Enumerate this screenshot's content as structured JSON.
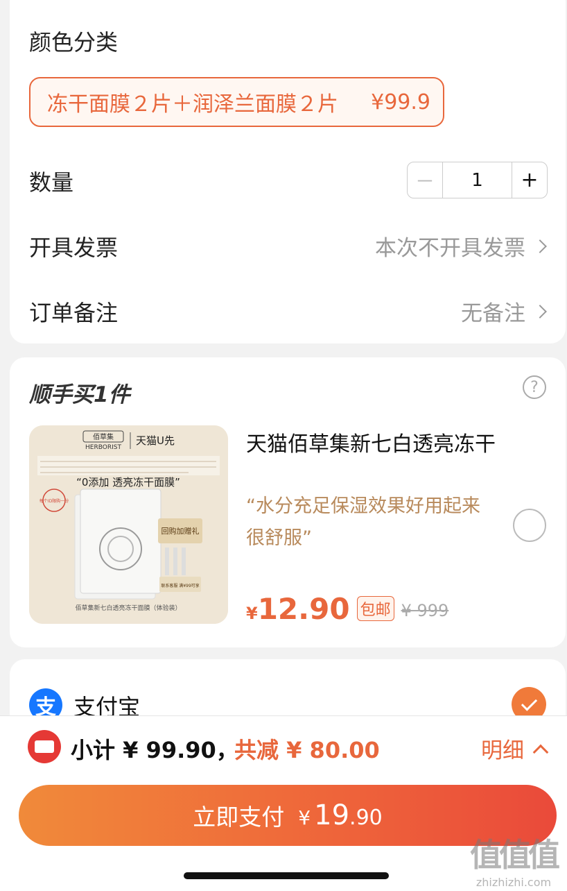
{
  "options": {
    "color_section_title": "颜色分类",
    "selected_sku": {
      "label": "冻干面膜２片＋润泽兰面膜２片",
      "price": "¥99.9"
    },
    "quantity_label": "数量",
    "quantity": {
      "minus": "－",
      "value": "1",
      "plus": "+"
    },
    "invoice_label": "开具发票",
    "invoice_value": "本次不开具发票",
    "remark_label": "订单备注",
    "remark_value": "无备注"
  },
  "addon": {
    "title": "顺手买1件",
    "help_icon": "?",
    "product": {
      "image_texts": {
        "brand": "佰草集",
        "brand_en": "HERBORIST",
        "channel": "天猫U先",
        "headline": "“0添加 透亮冻干面膜”",
        "stamp": "每个ID限购一份",
        "gift": "回购加赠礼",
        "gift_note": "联系客服 满¥99可享",
        "footer": "佰草集新七白透亮冻干面膜（体验装）"
      },
      "name": "天猫佰草集新七白透亮冻干",
      "quote": "“水分充足保湿效果好用起来很舒服”",
      "price_currency": "¥",
      "price": "12.90",
      "badge": "包邮",
      "original_price": "¥ 999",
      "selected": false
    }
  },
  "payment": {
    "method": "支付宝",
    "icon_glyph": "支",
    "selected": true
  },
  "bottom": {
    "subtotal": "小计 ¥ 99.90，",
    "discount": "共减 ¥ 80.00",
    "detail": "明细",
    "pay_label": "立即支付",
    "pay_currency": "¥",
    "pay_int": "19",
    "pay_dec": ".90"
  },
  "watermark": {
    "big": "值值值",
    "small": "zhizhizhi.com"
  },
  "colors": {
    "accent": "#e8673c",
    "alipay": "#1677ff",
    "quote": "#b88a5c"
  }
}
